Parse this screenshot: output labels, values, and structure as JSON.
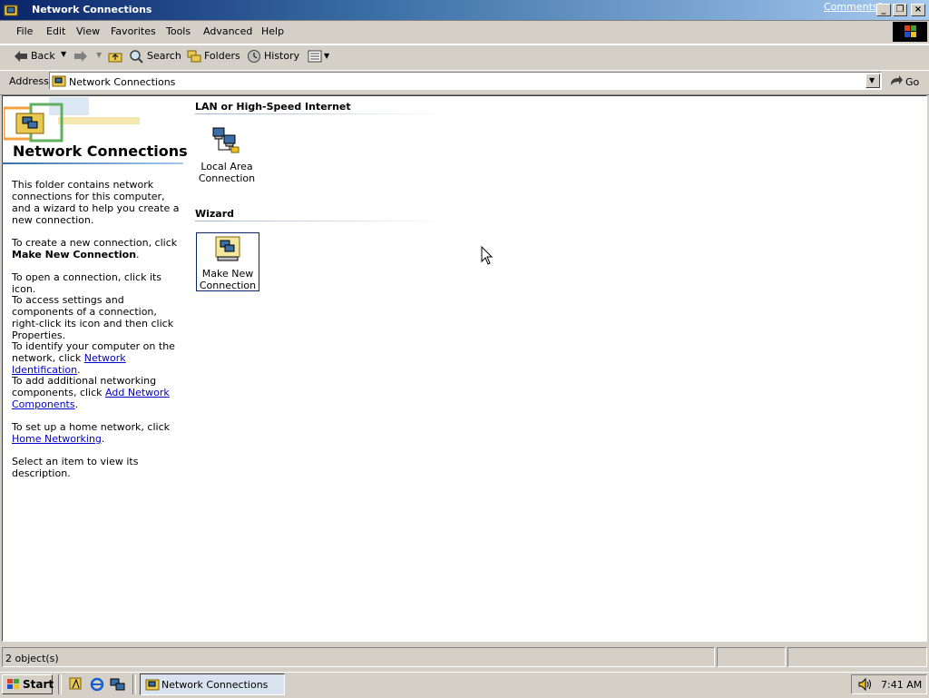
{
  "window": {
    "title": "Network Connections",
    "comments_link": "Comments?"
  },
  "menubar": {
    "items": [
      "File",
      "Edit",
      "View",
      "Favorites",
      "Tools",
      "Advanced",
      "Help"
    ]
  },
  "toolbar": {
    "back_label": "Back",
    "search_label": "Search",
    "folders_label": "Folders",
    "history_label": "History"
  },
  "address": {
    "label": "Address",
    "value": "Network Connections",
    "go_label": "Go"
  },
  "panel": {
    "title": "Network Connections",
    "intro": "This folder contains network connections for this computer, and a wizard to help you create a new connection.",
    "create_prefix": "To create a new connection, click",
    "create_bold": "Make New Connection",
    "open_text": "To open a connection, click its icon.",
    "access_text": "To access settings and components of a connection, right-click its icon and then click Properties.",
    "identify_prefix": "To identify your computer on the network, click",
    "identify_link": "Network Identification",
    "add_prefix": "To add additional networking components, click",
    "add_link": "Add Network Components",
    "home_prefix": "To set up a home network, click",
    "home_link": "Home Networking",
    "select_text": "Select an item to view its description."
  },
  "sections": {
    "lan_header": "LAN or High-Speed Internet",
    "lan_item": "Local Area Connection",
    "wizard_header": "Wizard",
    "wizard_item": "Make New Connection"
  },
  "status": {
    "objects": "2 object(s)"
  },
  "taskbar": {
    "start_label": "Start",
    "task_label": "Network Connections",
    "clock": "7:41 AM"
  },
  "icons": [
    "window-app-icon",
    "back-arrow-icon",
    "forward-arrow-icon",
    "up-folder-icon",
    "search-icon",
    "folders-icon",
    "history-icon",
    "views-icon",
    "address-folder-icon",
    "go-arrow-icon",
    "network-connection-icon",
    "make-new-connection-icon",
    "desktop-icon",
    "ie-icon",
    "quicklaunch-icon",
    "speaker-icon",
    "windows-flag-icon"
  ],
  "colors": {
    "title_start": "#0a246a",
    "title_end": "#a6caf0",
    "face": "#d4d0c8",
    "link": "#0000cc",
    "selection_border": "#0a246a"
  }
}
